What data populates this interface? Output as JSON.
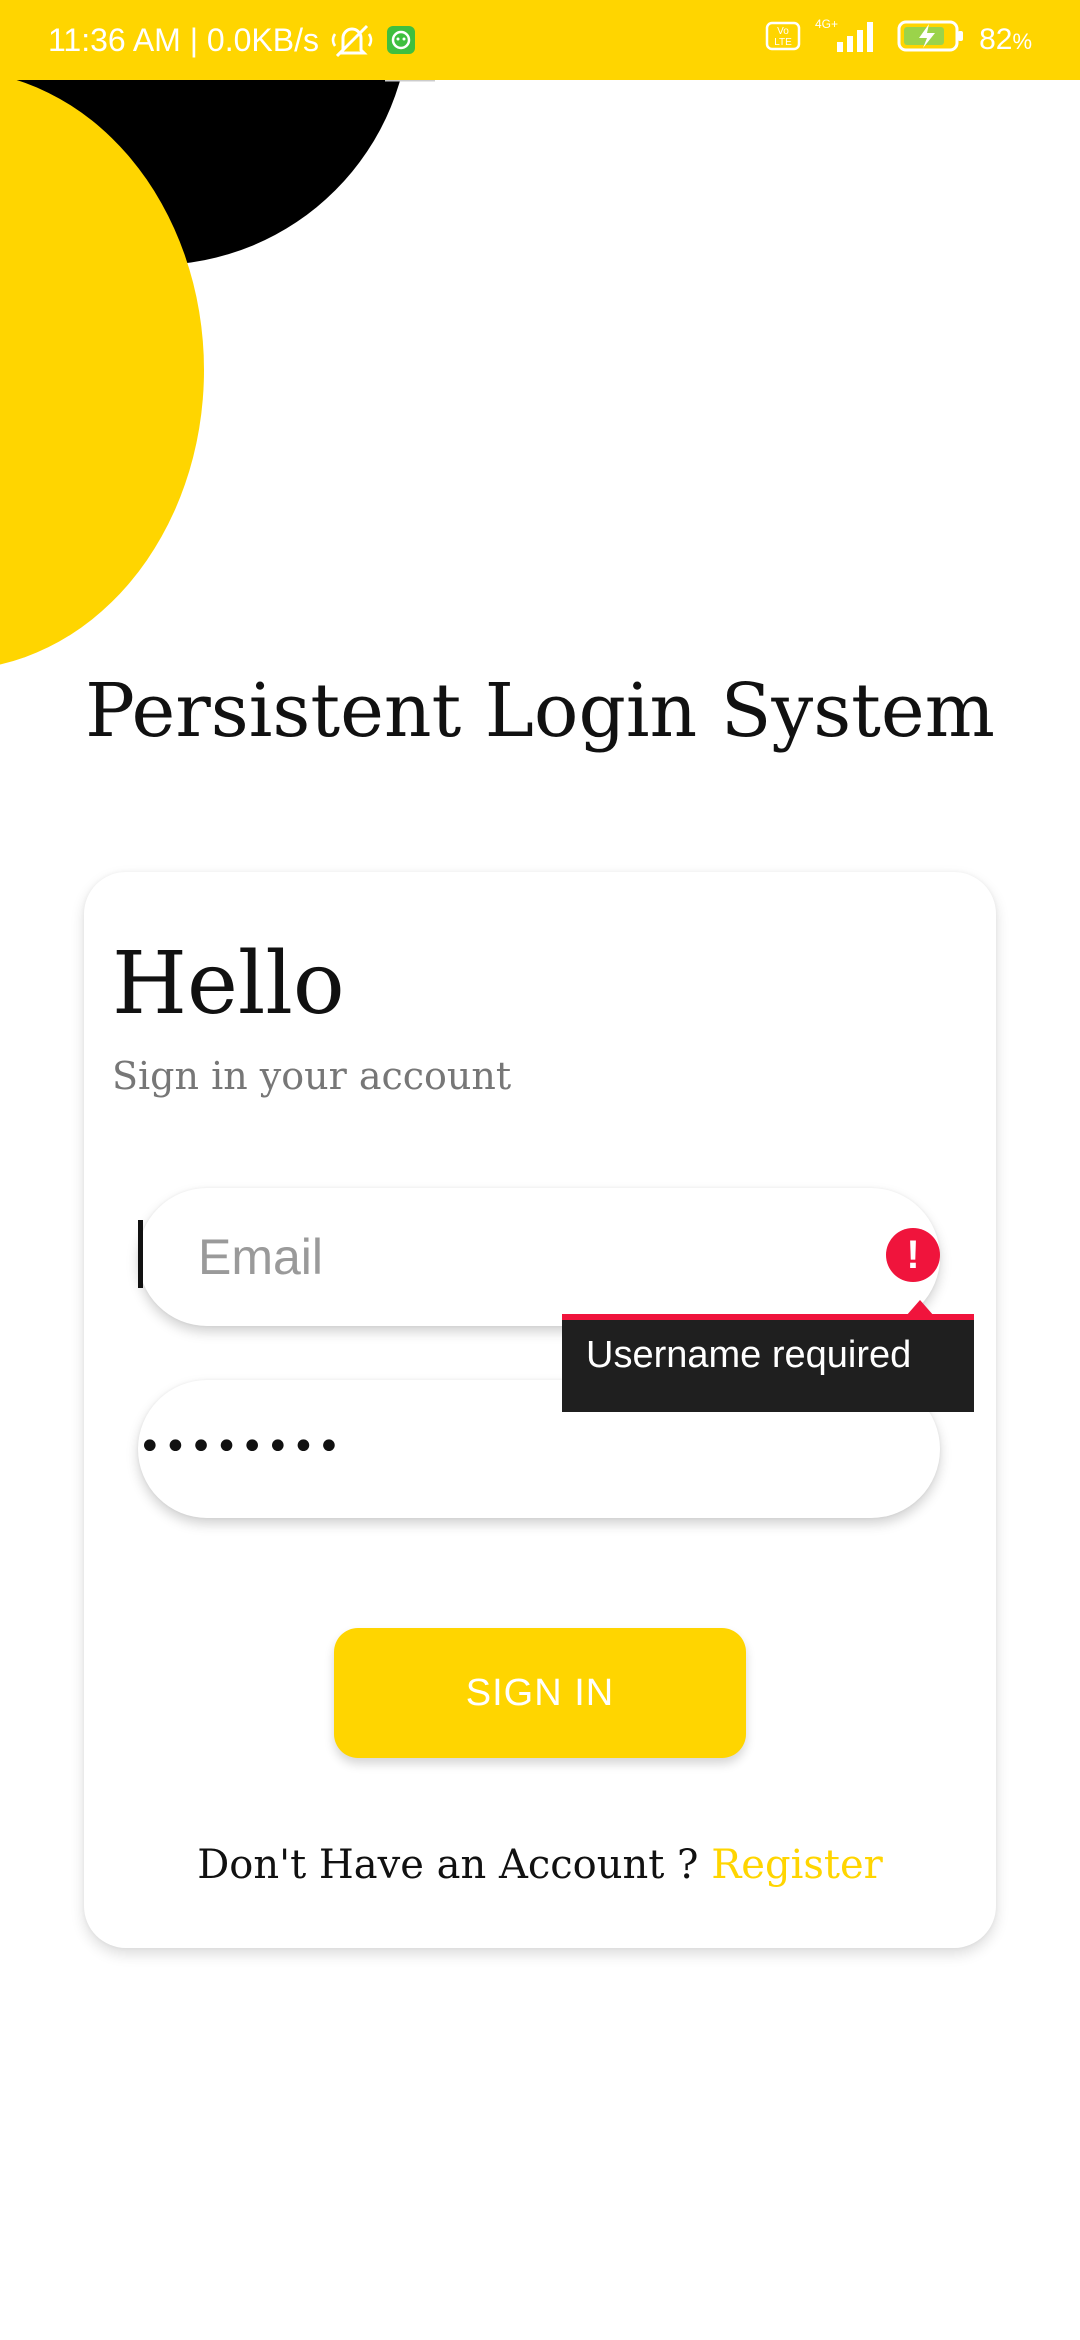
{
  "status_bar": {
    "time_network": "11:36 AM | 0.0KB/s",
    "battery_percent": "82",
    "battery_unit": "%",
    "network_badge": "4G+",
    "icons": [
      "mute-icon",
      "app-notification-icon",
      "volte-icon",
      "signal-icon",
      "battery-charging-icon"
    ]
  },
  "app": {
    "title": "Persistent Login System"
  },
  "card": {
    "heading": "Hello",
    "subheading": "Sign in your account"
  },
  "form": {
    "email_placeholder": "Email",
    "password_masked": "••••••••",
    "error_tooltip": "Username required",
    "error_icon": "!",
    "signin_label": "SIGN IN"
  },
  "footer": {
    "prompt": "Don't Have an Account ? ",
    "register_label": "Register"
  },
  "colors": {
    "accent": "#FFD500",
    "error": "#F0143C",
    "decor_dark": "#000000"
  }
}
